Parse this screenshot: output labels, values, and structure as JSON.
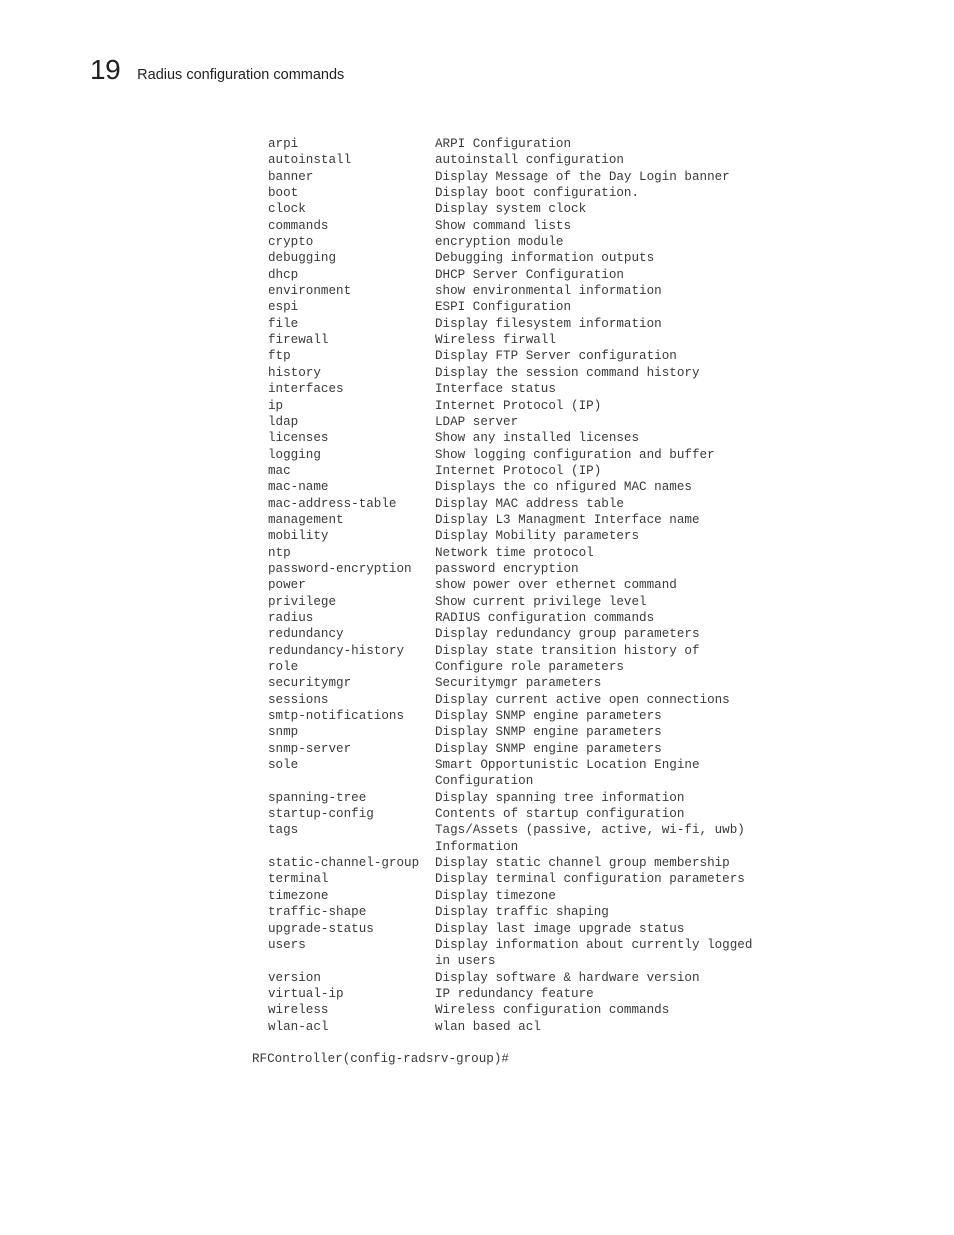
{
  "header": {
    "chapter_number": "19",
    "chapter_title": "Radius configuration commands"
  },
  "commands": [
    {
      "name": "arpi",
      "description": [
        "ARPI Configuration"
      ]
    },
    {
      "name": "autoinstall",
      "description": [
        "autoinstall configuration"
      ]
    },
    {
      "name": "banner",
      "description": [
        "Display Message of the Day Login banner"
      ]
    },
    {
      "name": "boot",
      "description": [
        "Display boot configuration."
      ]
    },
    {
      "name": "clock",
      "description": [
        "Display system clock"
      ]
    },
    {
      "name": "commands",
      "description": [
        "Show command lists"
      ]
    },
    {
      "name": "crypto",
      "description": [
        "encryption module"
      ]
    },
    {
      "name": "debugging",
      "description": [
        "Debugging information outputs"
      ]
    },
    {
      "name": "dhcp",
      "description": [
        "DHCP Server Configuration"
      ]
    },
    {
      "name": "environment",
      "description": [
        "show environmental information"
      ]
    },
    {
      "name": "espi",
      "description": [
        "ESPI Configuration"
      ]
    },
    {
      "name": "file",
      "description": [
        "Display filesystem information"
      ]
    },
    {
      "name": "firewall",
      "description": [
        "Wireless firwall"
      ]
    },
    {
      "name": "ftp",
      "description": [
        "Display FTP Server configuration"
      ]
    },
    {
      "name": "history",
      "description": [
        "Display the session command history"
      ]
    },
    {
      "name": "interfaces",
      "description": [
        "Interface status"
      ]
    },
    {
      "name": "ip",
      "description": [
        "Internet Protocol (IP)"
      ]
    },
    {
      "name": "ldap",
      "description": [
        "LDAP server"
      ]
    },
    {
      "name": "licenses",
      "description": [
        "Show any installed licenses"
      ]
    },
    {
      "name": "logging",
      "description": [
        "Show logging configuration and buffer"
      ]
    },
    {
      "name": "mac",
      "description": [
        "Internet Protocol (IP)"
      ]
    },
    {
      "name": "mac-name",
      "description": [
        "Displays the co nfigured MAC names"
      ]
    },
    {
      "name": "mac-address-table",
      "description": [
        "Display MAC address table"
      ]
    },
    {
      "name": "management",
      "description": [
        "Display L3 Managment Interface name"
      ]
    },
    {
      "name": "mobility",
      "description": [
        "Display Mobility parameters"
      ]
    },
    {
      "name": "ntp",
      "description": [
        "Network time protocol"
      ]
    },
    {
      "name": "password-encryption",
      "description": [
        "password encryption"
      ]
    },
    {
      "name": "power",
      "description": [
        "show power over ethernet command"
      ]
    },
    {
      "name": "privilege",
      "description": [
        "Show current privilege level"
      ]
    },
    {
      "name": "radius",
      "description": [
        "RADIUS configuration commands"
      ]
    },
    {
      "name": "redundancy",
      "description": [
        "Display redundancy group parameters"
      ]
    },
    {
      "name": "redundancy-history",
      "description": [
        "Display state transition history of"
      ]
    },
    {
      "name": "role",
      "description": [
        "Configure role parameters"
      ]
    },
    {
      "name": "securitymgr",
      "description": [
        "Securitymgr parameters"
      ]
    },
    {
      "name": "sessions",
      "description": [
        "Display current active open connections"
      ]
    },
    {
      "name": "smtp-notifications",
      "description": [
        "Display SNMP engine parameters"
      ]
    },
    {
      "name": "snmp",
      "description": [
        "Display SNMP engine parameters"
      ]
    },
    {
      "name": "snmp-server",
      "description": [
        "Display SNMP engine parameters"
      ]
    },
    {
      "name": "sole",
      "description": [
        "Smart Opportunistic Location Engine",
        "Configuration"
      ]
    },
    {
      "name": "spanning-tree",
      "description": [
        "Display spanning tree information"
      ]
    },
    {
      "name": "startup-config",
      "description": [
        "Contents of startup configuration"
      ]
    },
    {
      "name": "tags",
      "description": [
        "Tags/Assets (passive, active, wi-fi, uwb)",
        "Information"
      ]
    },
    {
      "name": "static-channel-group",
      "description": [
        "Display static channel group membership"
      ]
    },
    {
      "name": "terminal",
      "description": [
        "Display terminal configuration parameters"
      ]
    },
    {
      "name": "timezone",
      "description": [
        "Display timezone"
      ]
    },
    {
      "name": "traffic-shape",
      "description": [
        "Display traffic shaping"
      ]
    },
    {
      "name": "upgrade-status",
      "description": [
        "Display last image upgrade status"
      ]
    },
    {
      "name": "users",
      "description": [
        "Display information about currently logged",
        "in users"
      ]
    },
    {
      "name": "version",
      "description": [
        "Display software & hardware version"
      ]
    },
    {
      "name": "virtual-ip",
      "description": [
        "IP redundancy feature"
      ]
    },
    {
      "name": "wireless",
      "description": [
        "Wireless configuration commands"
      ]
    },
    {
      "name": "wlan-acl",
      "description": [
        "wlan based acl"
      ]
    }
  ],
  "prompt": "RFController(config-radsrv-group)#"
}
